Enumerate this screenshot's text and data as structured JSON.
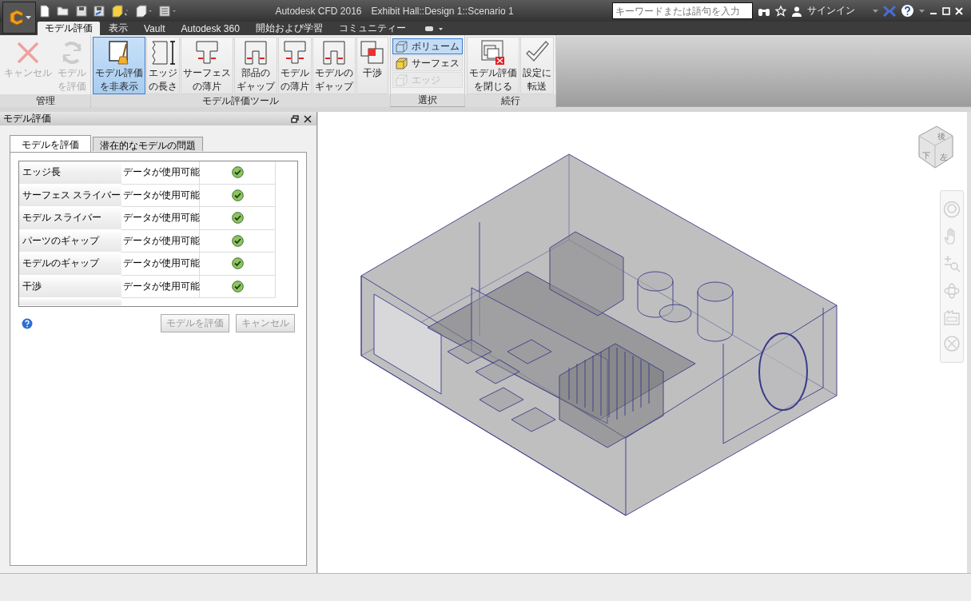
{
  "window": {
    "app_name": "Autodesk CFD 2016",
    "document": "Exhibit Hall::Design 1::Scenario 1"
  },
  "search": {
    "placeholder": "キーワードまたは語句を入力"
  },
  "sign_in": "サインイン",
  "ribbon_tabs": [
    {
      "label": "モデル評価",
      "selected": true
    },
    {
      "label": "表示",
      "selected": false
    },
    {
      "label": "Vault",
      "selected": false
    },
    {
      "label": "Autodesk 360",
      "selected": false
    },
    {
      "label": "開始および学習",
      "selected": false
    },
    {
      "label": "コミュニティー",
      "selected": false
    }
  ],
  "ribbon_groups": [
    {
      "label": "管理",
      "kind": "large",
      "buttons": [
        {
          "label": "キャンセル",
          "disabled": true
        },
        {
          "label": "モデルを評価",
          "disabled": true
        }
      ]
    },
    {
      "label": "モデル評価ツール",
      "kind": "large",
      "buttons": [
        {
          "label": "モデル評価を非表示",
          "disabled": false,
          "selected": true
        },
        {
          "label": "エッジの長さ",
          "disabled": false,
          "selected": false
        },
        {
          "label": "サーフェスの薄片",
          "disabled": false,
          "selected": false
        },
        {
          "label": "部品のギャップ",
          "disabled": false,
          "selected": false
        },
        {
          "label": "モデルの薄片",
          "disabled": false,
          "selected": false
        },
        {
          "label": "モデルのギャップ",
          "disabled": false,
          "selected": false
        },
        {
          "label": "干渉",
          "disabled": false,
          "selected": false
        }
      ]
    },
    {
      "label": "選択",
      "kind": "list",
      "buttons": [
        {
          "label": "ボリューム",
          "disabled": false,
          "selected": true
        },
        {
          "label": "サーフェス",
          "disabled": false,
          "selected": false
        },
        {
          "label": "エッジ",
          "disabled": true,
          "selected": false
        }
      ]
    },
    {
      "label": "続行",
      "kind": "large",
      "buttons": [
        {
          "label": "モデル評価を閉じる",
          "disabled": false
        },
        {
          "label": "設定に転送",
          "disabled": false
        }
      ]
    }
  ],
  "panel": {
    "title": "モデル評価",
    "tabs": [
      {
        "label": "モデルを評価",
        "selected": true
      },
      {
        "label": "潜在的なモデルの問題",
        "selected": false
      }
    ],
    "rows": [
      {
        "name": "エッジ長",
        "status": "データが使用可能",
        "passed": true
      },
      {
        "name": "サーフェス スライバー",
        "status": "データが使用可能",
        "passed": true
      },
      {
        "name": "モデル スライバー",
        "status": "データが使用可能",
        "passed": true
      },
      {
        "name": "パーツのギャップ",
        "status": "データが使用可能",
        "passed": true
      },
      {
        "name": "モデルのギャップ",
        "status": "データが使用可能",
        "passed": true
      },
      {
        "name": "干渉",
        "status": "データが使用可能",
        "passed": true
      }
    ],
    "buttons": [
      {
        "label": "モデルを評価",
        "disabled": true
      },
      {
        "label": "キャンセル",
        "disabled": true
      }
    ]
  },
  "view_cube": {
    "faces": [
      "後",
      "下",
      "左"
    ]
  }
}
